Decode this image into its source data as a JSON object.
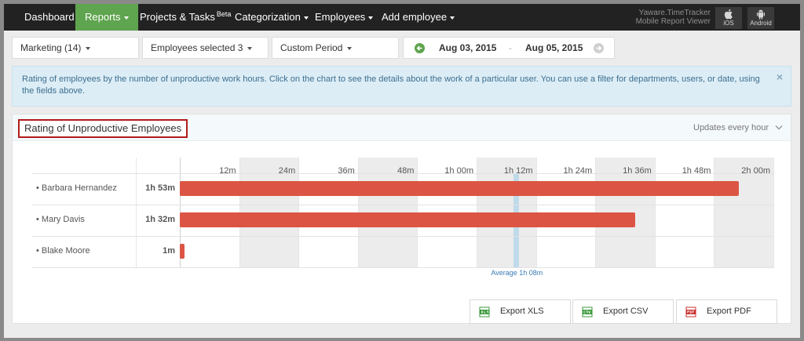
{
  "nav": {
    "items": [
      {
        "label": "Dashboard"
      },
      {
        "label": "Reports"
      },
      {
        "label": "Projects & Tasks",
        "badge": "Beta"
      },
      {
        "label": "Categorization"
      },
      {
        "label": "Employees"
      },
      {
        "label": "Add employee"
      }
    ],
    "mobile": {
      "line1": "Yaware.TimeTracker",
      "line2": "Mobile Report Viewer",
      "ios": "iOS",
      "android": "Android"
    }
  },
  "filters": {
    "department": "Marketing (14)",
    "employees": "Employees selected 3",
    "period": "Custom Period",
    "date_from": "Aug 03, 2015",
    "date_separator": "-",
    "date_to": "Aug 05, 2015"
  },
  "info": {
    "text": "Rating of employees by the number of unproductive work hours. Click on the chart to see the details about the work of a particular user. You can use a filter for departments, users, or date, using the fields above.",
    "close": "×"
  },
  "panel": {
    "title": "Rating of Unproductive Employees",
    "updates": "Updates every hour"
  },
  "chart_data": {
    "type": "bar",
    "orientation": "horizontal",
    "unit": "minutes",
    "categories": [
      "Barbara Hernandez",
      "Mary Davis",
      "Blake Moore"
    ],
    "values": [
      113,
      92,
      1
    ],
    "value_labels": [
      "1h 53m",
      "1h 32m",
      "1m"
    ],
    "x_ticks": [
      "12m",
      "24m",
      "36m",
      "48m",
      "1h 00m",
      "1h 12m",
      "1h 24m",
      "1h 36m",
      "1h 48m",
      "2h 00m"
    ],
    "xlim": [
      0,
      120
    ],
    "average": {
      "value": 68,
      "label": "Average 1h 08m"
    },
    "bar_color": "#dc5544",
    "average_color": "#b7d7ea"
  },
  "exports": [
    {
      "label": "Export XLS",
      "icon": "xls-file-icon",
      "color": "#3a9a3a"
    },
    {
      "label": "Export CSV",
      "icon": "csv-file-icon",
      "color": "#3a9a3a"
    },
    {
      "label": "Export PDF",
      "icon": "pdf-file-icon",
      "color": "#c9302c"
    }
  ]
}
